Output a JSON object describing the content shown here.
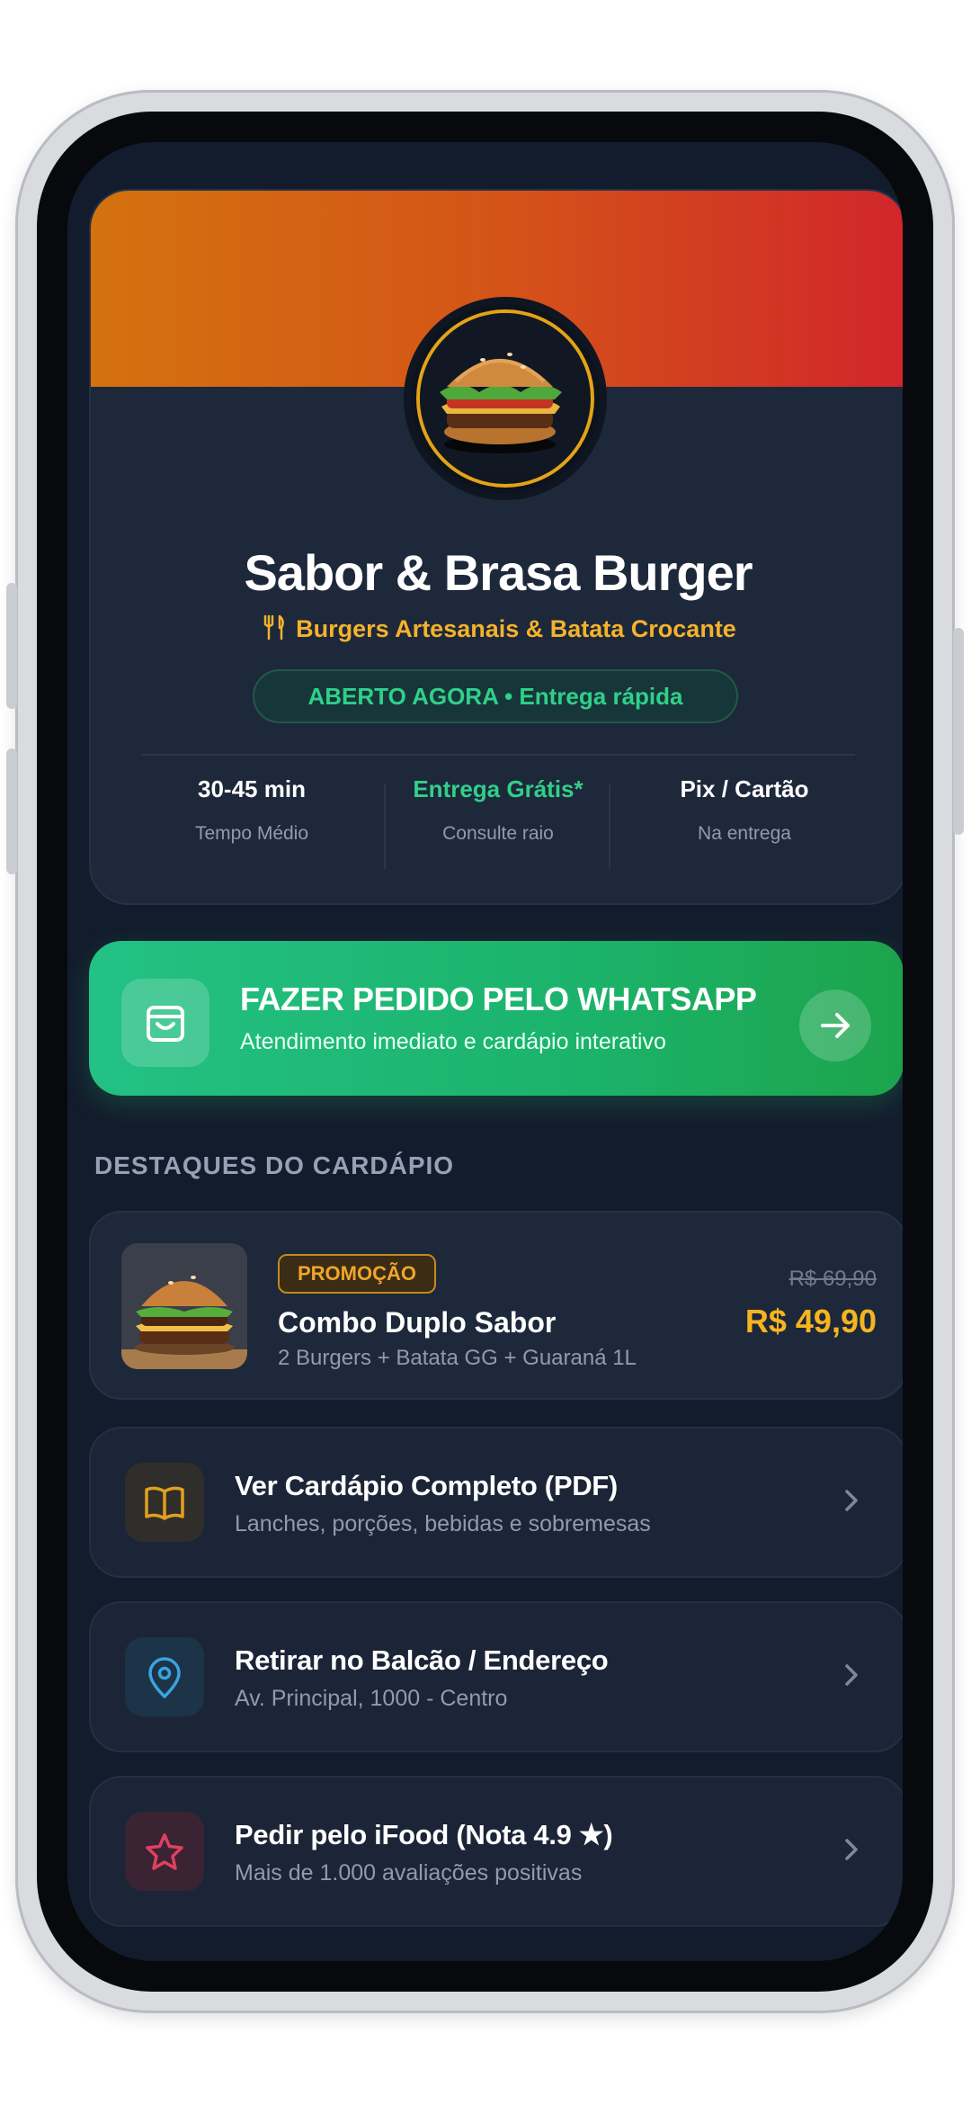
{
  "profile": {
    "name": "Sabor & Brasa Burger",
    "tagline": "Burgers Artesanais & Batata Crocante",
    "status": "ABERTO AGORA • Entrega rápida",
    "stats": [
      {
        "value": "30-45 min",
        "label": "Tempo Médio",
        "color": "#ffffff"
      },
      {
        "value": "Entrega Grátis*",
        "label": "Consulte raio",
        "color": "#31cf88"
      },
      {
        "value": "Pix / Cartão",
        "label": "Na entrega",
        "color": "#ffffff"
      }
    ]
  },
  "cta": {
    "title": "FAZER PEDIDO PELO WHATSAPP",
    "subtitle": "Atendimento imediato e cardápio interativo"
  },
  "section": {
    "highlights_label": "DESTAQUES DO CARDÁPIO"
  },
  "promo": {
    "badge": "PROMOÇÃO",
    "title": "Combo Duplo Sabor",
    "description": "2 Burgers + Batata GG + Guaraná 1L",
    "old_price": "R$ 69,90",
    "price": "R$ 49,90"
  },
  "links": [
    {
      "title": "Ver Cardápio Completo (PDF)",
      "subtitle": "Lanches, porções, bebidas e sobremesas",
      "icon": "book-icon",
      "accent": "#e0a020"
    },
    {
      "title": "Retirar no Balcão / Endereço",
      "subtitle": "Av. Principal, 1000 - Centro",
      "icon": "map-pin-icon",
      "accent": "#3ba3e0"
    },
    {
      "title": "Pedir pelo iFood (Nota 4.9 ★)",
      "subtitle": "Mais de 1.000 avaliações positivas",
      "icon": "star-icon",
      "accent": "#e04060"
    }
  ],
  "colors": {
    "accent_orange": "#d4720f",
    "accent_red": "#d1262a",
    "whatsapp_green": "#1bb36b",
    "price_yellow": "#f6b51f"
  }
}
